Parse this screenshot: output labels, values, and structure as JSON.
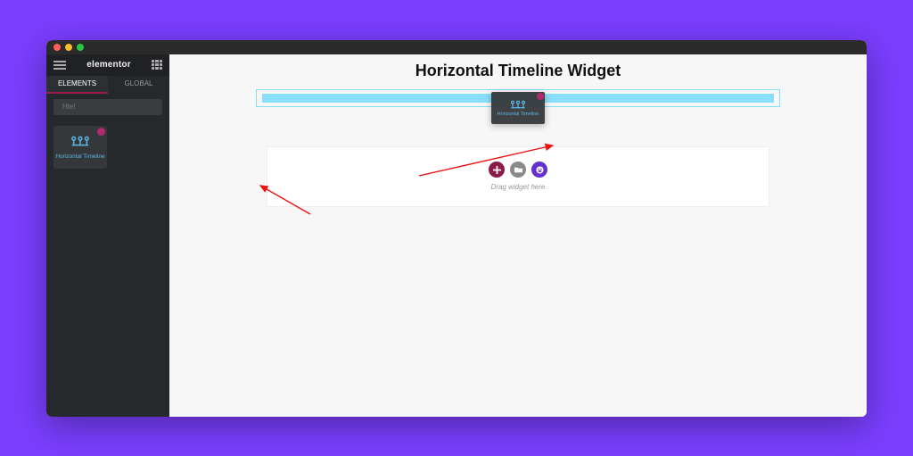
{
  "brand": "elementor",
  "tabs": {
    "elements": "ELEMENTS",
    "global": "GLOBAL"
  },
  "search": {
    "placeholder": "Htel"
  },
  "widget": {
    "label": "Horizontal Timeline"
  },
  "canvas": {
    "title": "Horizontal Timeline Widget",
    "drag_ghost_label": "Horizontal Timeline",
    "empty_hint": "Drag widget here"
  },
  "icons": {
    "menu": "menu-icon",
    "apps": "apps-grid-icon",
    "search": "search-icon",
    "timeline": "horizontal-timeline-icon",
    "plus": "plus-icon",
    "folder": "folder-icon",
    "save": "save-template-icon",
    "collapse": "collapse-panel-icon"
  }
}
